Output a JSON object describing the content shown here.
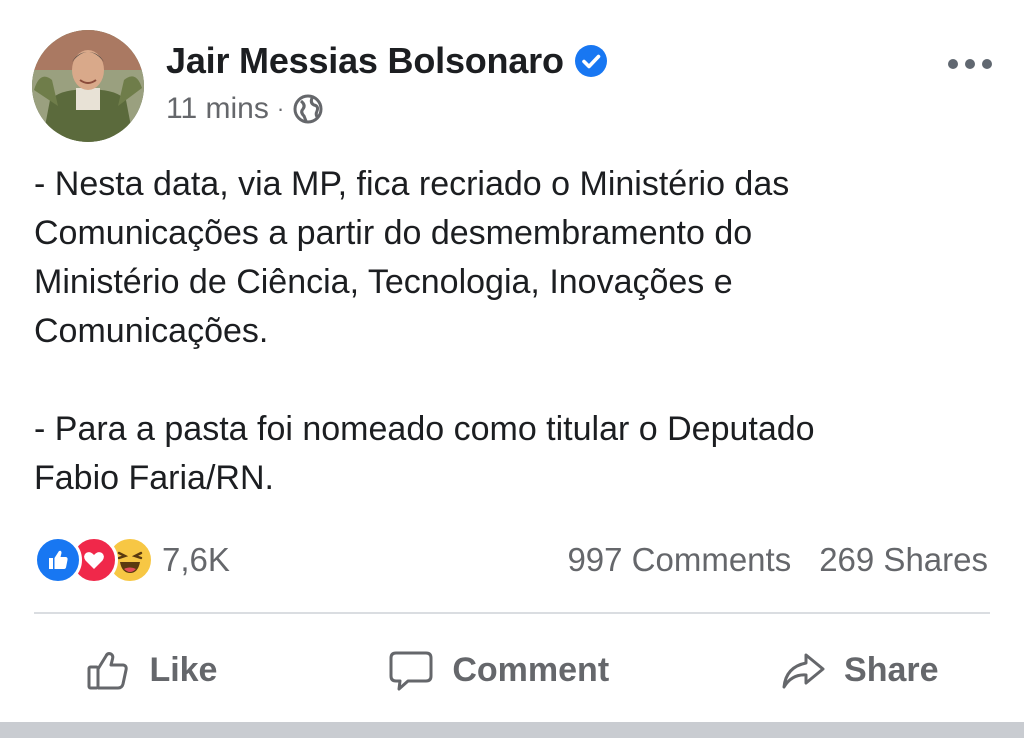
{
  "post": {
    "author": "Jair Messias Bolsonaro",
    "time": "11 mins",
    "separator": "·",
    "privacy_icon": "globe-icon",
    "verified_icon": "verified-badge-icon",
    "body": "- Nesta data, via MP, fica recriado o Ministério das\nComunicações a partir do desmembramento do\nMinistério de Ciência, Tecnologia, Inovações e\nComunicações.\n\n- Para a pasta foi nomeado como titular o Deputado\nFabio Faria/RN.",
    "reactions": {
      "icons": [
        "like-reaction-icon",
        "love-reaction-icon",
        "haha-reaction-icon"
      ],
      "count": "7,6K"
    },
    "comments": "997 Comments",
    "shares": "269 Shares"
  },
  "actions": {
    "like": "Like",
    "comment": "Comment",
    "share": "Share"
  },
  "colors": {
    "accent": "#1877f2",
    "text": "#1c1e21",
    "secondary": "#65676b",
    "love": "#f0284a",
    "haha": "#f7c744"
  }
}
